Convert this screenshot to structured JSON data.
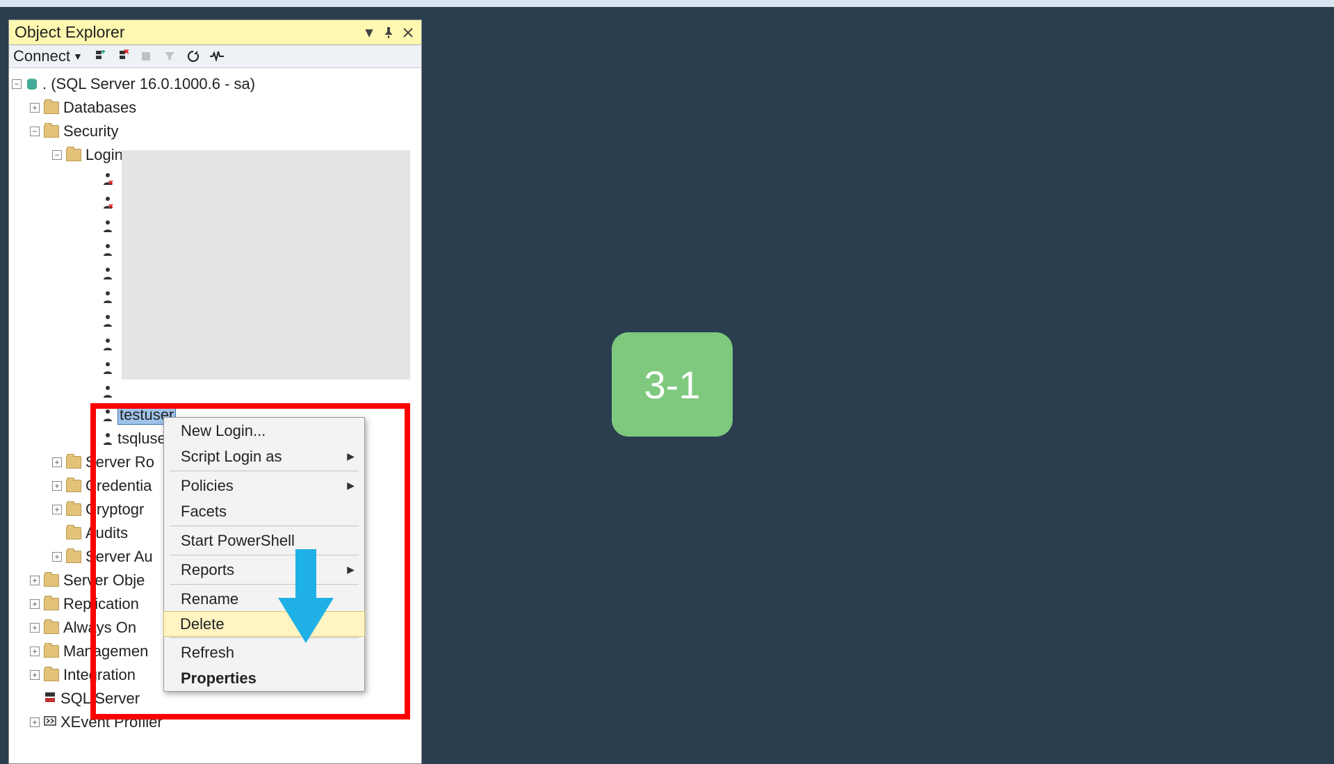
{
  "panel": {
    "title": "Object Explorer"
  },
  "toolbar": {
    "connect": "Connect"
  },
  "tree": {
    "server": ". (SQL Server 16.0.1000.6 - sa)",
    "databases": "Databases",
    "security": "Security",
    "logins": "Logins",
    "selected_login": "testuser",
    "next_login": "tsqluse",
    "server_roles": "Server Ro",
    "credentials": "Credentia",
    "crypto": "Cryptogr",
    "audits": "Audits",
    "server_audits": "Server Au",
    "server_objects": "Server Obje",
    "replication": "Replication",
    "always_on": "Always On",
    "management": "Managemen",
    "integration": "Integration",
    "sql_agent": "SQL Server",
    "xevent": "XEvent Profiler"
  },
  "context_menu": {
    "new_login": "New Login...",
    "script": "Script Login as",
    "policies": "Policies",
    "facets": "Facets",
    "powershell": "Start PowerShell",
    "reports": "Reports",
    "rename": "Rename",
    "delete": "Delete",
    "refresh": "Refresh",
    "properties": "Properties"
  },
  "badge": "3-1"
}
